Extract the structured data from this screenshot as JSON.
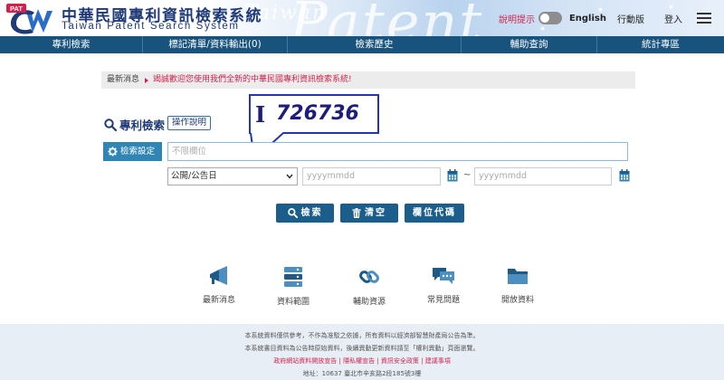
{
  "header": {
    "logo_text": "PAT",
    "title_cn": "中華民國專利資訊檢索系統",
    "title_en": "Taiwan Patent Search System",
    "watermark": "Patent",
    "watermark_small": "Taiwan",
    "hint_label": "說明提示",
    "lang_label": "English",
    "mobile_label": "行動版",
    "login_label": "登入"
  },
  "nav": {
    "items": [
      "專利檢索",
      "標記清單/資料輸出(0)",
      "檢索歷史",
      "輔助查詢",
      "統計專區"
    ]
  },
  "news": {
    "label": "最新消息",
    "message": "竭誠歡迎您使用我們全新的中華民國專利資訊檢索系統!"
  },
  "search": {
    "title": "專利檢索",
    "help_label": "操作說明",
    "settings_label": "檢索設定",
    "field_placeholder": "不限欄位",
    "date_type": "公開/公告日",
    "date_from_placeholder": "yyyymmdd",
    "date_to_placeholder": "yyyymmdd",
    "range_sep": "~",
    "search_button": "檢索",
    "clear_button": "清空",
    "fieldcode_button": "欄位代碼"
  },
  "callout": {
    "cursor_glyph": "I",
    "value": "726736"
  },
  "quick_links": [
    {
      "label": "最新消息",
      "icon": "megaphone-icon"
    },
    {
      "label": "資料範圍",
      "icon": "server-icon"
    },
    {
      "label": "輔助資源",
      "icon": "link-icon"
    },
    {
      "label": "常見問題",
      "icon": "chat-icon"
    },
    {
      "label": "開放資料",
      "icon": "folder-icon"
    }
  ],
  "footer": {
    "line1": "本系統資料僅供參考，不作為准駁之依據，所有資料以經濟部智慧財產局公告為準。",
    "line2": "本系統書目資料為公告時原始資料，後續異動更新資料請至「權利異動」頁面瀏覽。",
    "links": "政府網站資料開放宣告 | 隱私權宣告 | 資訊安全政策 | 建議事項",
    "address": "地址：10637 臺北市辛亥路2段185號3樓"
  },
  "colors": {
    "nav_bg": "#17537c",
    "button_bg": "#1b5e8c",
    "settings_bg": "#2f85b3",
    "accent_red": "#d0234c",
    "callout_border": "#2635b0"
  }
}
